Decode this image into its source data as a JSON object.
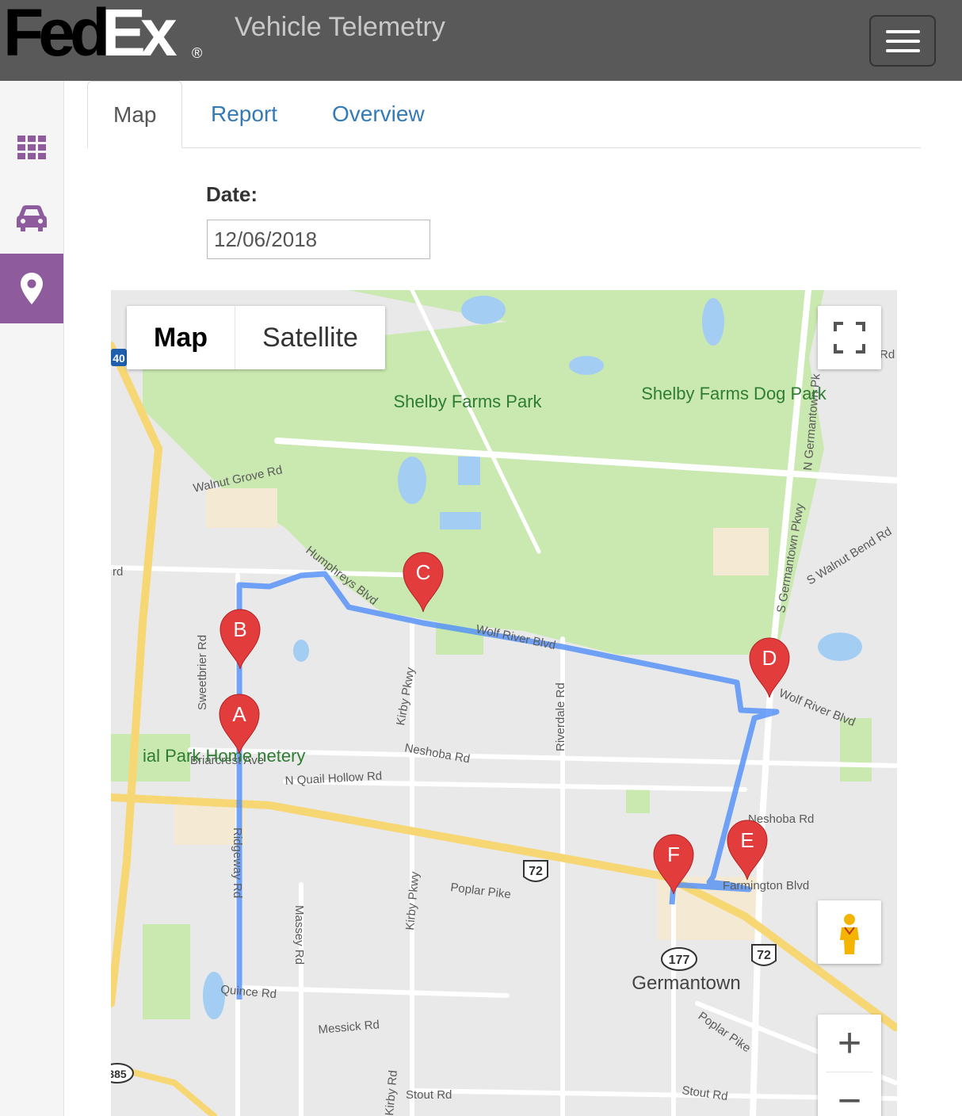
{
  "header": {
    "logo_fed": "Fed",
    "logo_ex": "Ex",
    "logo_reg": "®",
    "title": "Vehicle Telemetry"
  },
  "sidebar": {
    "items": [
      {
        "icon": "grid-icon",
        "active": false
      },
      {
        "icon": "car-icon",
        "active": false
      },
      {
        "icon": "map-marker-icon",
        "active": true
      }
    ]
  },
  "tabs": [
    {
      "label": "Map",
      "active": true
    },
    {
      "label": "Report",
      "active": false
    },
    {
      "label": "Overview",
      "active": false
    }
  ],
  "date": {
    "label": "Date:",
    "value": "12/06/2018"
  },
  "map": {
    "type_control": {
      "map": "Map",
      "satellite": "Satellite"
    },
    "markers": [
      "A",
      "B",
      "C",
      "D",
      "E",
      "F"
    ],
    "place_labels": {
      "park": "Shelby Farms Park",
      "dog_park": "Shelby Farms Dog Park",
      "memorial": "ial Park Home netery",
      "town": "Germantown"
    },
    "road_labels": {
      "walnut_grove": "Walnut Grove Rd",
      "humphreys": "Humphreys Blvd",
      "wolf_river": "Wolf River Blvd",
      "wolf_river_2": "Wolf River Blvd",
      "sweetbrier": "Sweetbrier Rd",
      "briarcrest": "Briarcrest Ave",
      "quail_hollow": "N Quail Hollow Rd",
      "neshoba": "Neshoba Rd",
      "neshoba_2": "Neshoba Rd",
      "kirby": "Kirby Pkwy",
      "kirby_2": "Kirby Pkwy",
      "kirby_rd": "Kirby Rd",
      "riverdale": "Riverdale Rd",
      "ridgeway": "Ridgeway Rd",
      "massey": "Massey Rd",
      "poplar": "Poplar Pike",
      "poplar_2": "Poplar Pike",
      "farmington": "Farmington Blvd",
      "quince": "Quince Rd",
      "messick": "Messick Rd",
      "stout": "Stout Rd",
      "stout_2": "Stout Rd",
      "germantown_pk": "N Germantown Pk",
      "germantown_pkwy": "S Germantown Pkwy",
      "walnut_bend": "S Walnut Bend Rd",
      "rd_left": "rd",
      "rd_right": "Rd"
    },
    "shields": {
      "i40": "40",
      "us72a": "72",
      "us72b": "72",
      "sr177": "177",
      "sr385": "385"
    },
    "zoom_in": "+",
    "zoom_out": "−"
  }
}
